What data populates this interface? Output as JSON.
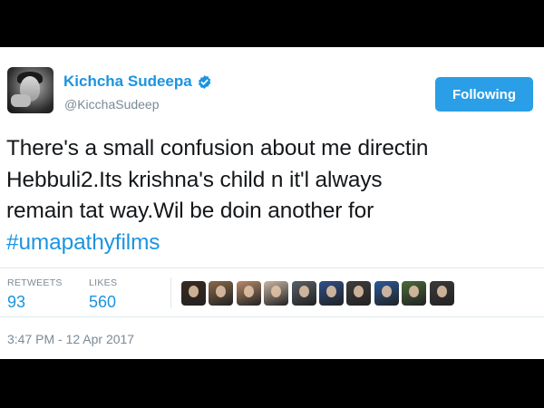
{
  "tweet": {
    "author": {
      "display_name": "Kichcha Sudeepa",
      "handle": "@KicchaSudeep",
      "verified": true,
      "avatar_icon": "profile-photo"
    },
    "follow_button_label": "Following",
    "text_lines": [
      "There's a small confusion about me directin",
      "Hebbuli2.Its krishna's child n it'l always",
      "remain tat way.Wil be doin another for"
    ],
    "hashtag": "#umapathyfilms",
    "stats": {
      "retweets_label": "RETWEETS",
      "retweets_count": "93",
      "likes_label": "LIKES",
      "likes_count": "560"
    },
    "likers": [
      {
        "name": "liker-1",
        "color": "#3a2a1e"
      },
      {
        "name": "liker-2",
        "color": "#8a6a4a"
      },
      {
        "name": "liker-3",
        "color": "#b88a6a"
      },
      {
        "name": "liker-4",
        "color": "#c9b7a4"
      },
      {
        "name": "liker-5",
        "color": "#5a6066"
      },
      {
        "name": "liker-6",
        "color": "#2f4f8a"
      },
      {
        "name": "liker-7",
        "color": "#3d3d3d"
      },
      {
        "name": "liker-8",
        "color": "#2a5a9a"
      },
      {
        "name": "liker-9",
        "color": "#4a6a3a"
      },
      {
        "name": "liker-10",
        "color": "#3a3a3a"
      }
    ],
    "timestamp": "3:47 PM - 12 Apr 2017"
  },
  "colors": {
    "link_blue": "#1c94e0",
    "button_blue": "#2a9ee6",
    "muted_gray": "#7a8a96",
    "text_dark": "#14171a"
  }
}
